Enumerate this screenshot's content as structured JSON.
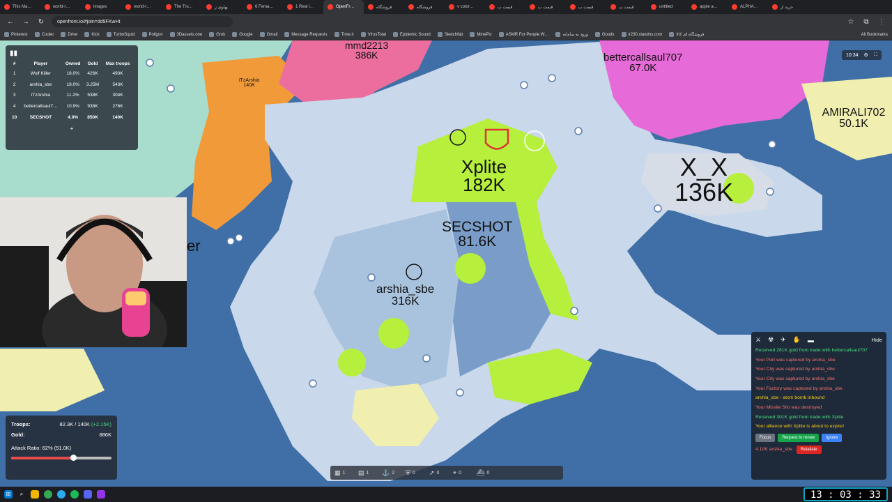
{
  "browser": {
    "tabs": [
      "This Ma…",
      "world-r…",
      "images",
      "world-r…",
      "The Tru…",
      "پهلوی ز",
      "6 Fema…",
      "1 Real I…",
      "OpenFr…",
      "فروشگاه",
      "فروشگاه",
      "v color…",
      "قیمت ب",
      "قیمت ب",
      "قیمت ب",
      "قیمت ب",
      "untitled",
      "apple a…",
      "ALPHA…",
      "خرید از"
    ],
    "active_tab_index": 8,
    "url": "openfront.io/#join=dd9FKwHt",
    "bookmarks": [
      "Pinterest",
      "Cooler",
      "Drive",
      "Kick",
      "TurboSquid",
      "Poligon",
      "3Dassets.one",
      "Grok",
      "Google",
      "Gmail",
      "Message Requests",
      "Time.ir",
      "VirusTotal",
      "Epidemic Sound",
      "Sketchfab",
      "MinePic",
      "ASMR For People W…",
      "ورود به سامانه",
      "Goods",
      "ir230.xiandns.com",
      "فروشگاه ای کالا"
    ],
    "all_bookmarks": "All Bookmarks"
  },
  "leaderboard": {
    "headers": [
      "#",
      "Player",
      "Owned",
      "Gold",
      "Max troops"
    ],
    "rows": [
      {
        "rank": "1",
        "player": "Wolf Killer",
        "owned": "18.0%",
        "gold": "426K",
        "troops": "493K"
      },
      {
        "rank": "2",
        "player": "arshia_sbe",
        "owned": "18.0%",
        "gold": "3.25M",
        "troops": "543K"
      },
      {
        "rank": "3",
        "player": "iTzArshia",
        "owned": "11.2%",
        "gold": "538K",
        "troops": "304K"
      },
      {
        "rank": "4",
        "player": "bettercallsaul7…",
        "owned": "10.9%",
        "gold": "938K",
        "troops": "276K"
      },
      {
        "rank": "10",
        "player": "SECSHOT",
        "owned": "4.0%",
        "gold": "850K",
        "troops": "140K"
      }
    ],
    "more": "+"
  },
  "territories": {
    "mmd": {
      "name": "mmd2213",
      "troops": "386K"
    },
    "itz": {
      "name": "iTzArshia",
      "troops": "140K"
    },
    "saul": {
      "name": "bettercallsaul707",
      "troops": "67.0K"
    },
    "amirali": {
      "name": "AMIRALI702",
      "troops": "50.1K"
    },
    "xplite": {
      "name": "Xplite",
      "troops": "182K"
    },
    "xx": {
      "name": "X_X",
      "troops": "136K"
    },
    "secshot": {
      "name": "SECSHOT",
      "troops": "81.6K"
    },
    "arshia": {
      "name": "arshia_sbe",
      "troops": "316K"
    },
    "partial": {
      "name": "er"
    }
  },
  "stats": {
    "troops_label": "Troops:",
    "troops_value": "82.3K / 140K",
    "troops_rate": "(+2.15K)",
    "gold_label": "Gold:",
    "gold_value": "886K",
    "attack_ratio": "Attack Ratio: 62% (51.0K)",
    "attack_fraction": 0.62
  },
  "events": {
    "hide": "Hide",
    "items": [
      {
        "text": "Received 281K gold from trade with bettercallsaul707",
        "color": "#4ade80"
      },
      {
        "text": "Your Port was captured by arshia_sbe",
        "color": "#f87171"
      },
      {
        "text": "Your City was captured by arshia_sbe",
        "color": "#f87171"
      },
      {
        "text": "Your City was captured by arshia_sbe",
        "color": "#f87171"
      },
      {
        "text": "Your Factory was captured by arshia_sbe",
        "color": "#f87171"
      },
      {
        "text": "arshia_sbe - atom bomb inbound",
        "color": "#facc15"
      },
      {
        "text": "Your Missile Silo was destroyed",
        "color": "#f87171"
      },
      {
        "text": "Received 301K gold from trade with Xplite",
        "color": "#4ade80"
      },
      {
        "text": "Your alliance with Xplite is about to expire!",
        "color": "#facc15"
      }
    ],
    "buttons": {
      "focus": "Focus",
      "renew": "Request to renew",
      "ignore": "Ignore"
    },
    "last": {
      "text": "4.10K arshia_sbe",
      "button": "Retaliate"
    }
  },
  "actionbar": {
    "counts": [
      "1",
      "1",
      "2",
      "0",
      "0",
      "0",
      "0"
    ]
  },
  "topright": {
    "time": "10:34"
  },
  "clock": "13 : 03 : 33",
  "colors": {
    "ocean": "#3f6fa6",
    "neutral": "#c9d8ea",
    "xplite": "#b6ef3c",
    "secshot": "#7a9cc8",
    "arshia": "#a9c3df",
    "itz": "#f09a3a",
    "pink": "#ec6e9e",
    "magenta": "#e66bd8",
    "teal": "#a8dccd",
    "yellow": "#f0efb0"
  }
}
